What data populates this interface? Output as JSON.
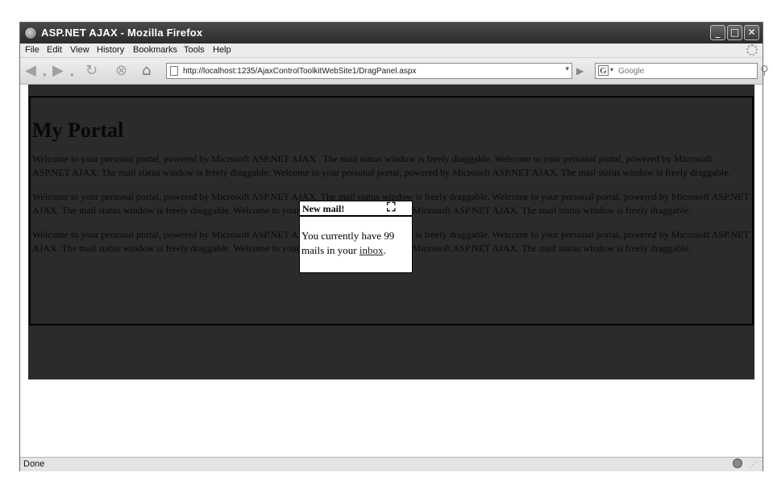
{
  "window": {
    "title": "ASP.NET AJAX - Mozilla Firefox",
    "controls": {
      "minimize": "_",
      "maximize": "□",
      "close": "✕"
    }
  },
  "menu": {
    "items": [
      "File",
      "Edit",
      "View",
      "History",
      "Bookmarks",
      "Tools",
      "Help"
    ]
  },
  "toolbar": {
    "back_icon": "back-arrow-icon",
    "forward_icon": "forward-arrow-icon",
    "reload_icon": "reload-icon",
    "stop_icon": "stop-icon",
    "home_icon": "home-icon",
    "url": "http://localhost:1235/AjaxControlToolkitWebSite1/DragPanel.aspx",
    "search_engine_letter": "G",
    "search_placeholder": "Google"
  },
  "page": {
    "heading": "My Portal",
    "paragraphs": [
      "Welcome to your personal portal, powered by Microsoft ASP.NET AJAX . The mail status window is freely draggable. Welcome to your personal portal, powered by Microsoft ASP.NET AJAX. The mail status window is freely draggable. Welcome to your personal portal, powered by Microsoft ASP.NET AJAX. The mail status window is freely draggable.",
      "Welcome to your personal portal, powered by Microsoft ASP.NET AJAX. The mail status window is freely draggable. Welcome to your personal portal, powered by Microsoft ASP.NET AJAX. The mail status window is freely draggable. Welcome to your personal portal, powered by Microsoft ASP.NET AJAX. The mail status window is freely draggable.",
      "Welcome to your personal portal, powered by Microsoft ASP.NET AJAX. The mail status window is freely draggable. Welcome to your personal portal, powered by Microsoft ASP.NET AJAX. The mail status window is freely draggable. Welcome to your personal portal, powered by Microsoft ASP.NET AJAX. The mail status window is freely draggable."
    ]
  },
  "mail_panel": {
    "header": "New mail!",
    "drag_icon": "⛶",
    "text_before_link": "You currently have 99 mails in your ",
    "link": "inbox",
    "text_after_link": "."
  },
  "status": {
    "text": "Done"
  }
}
